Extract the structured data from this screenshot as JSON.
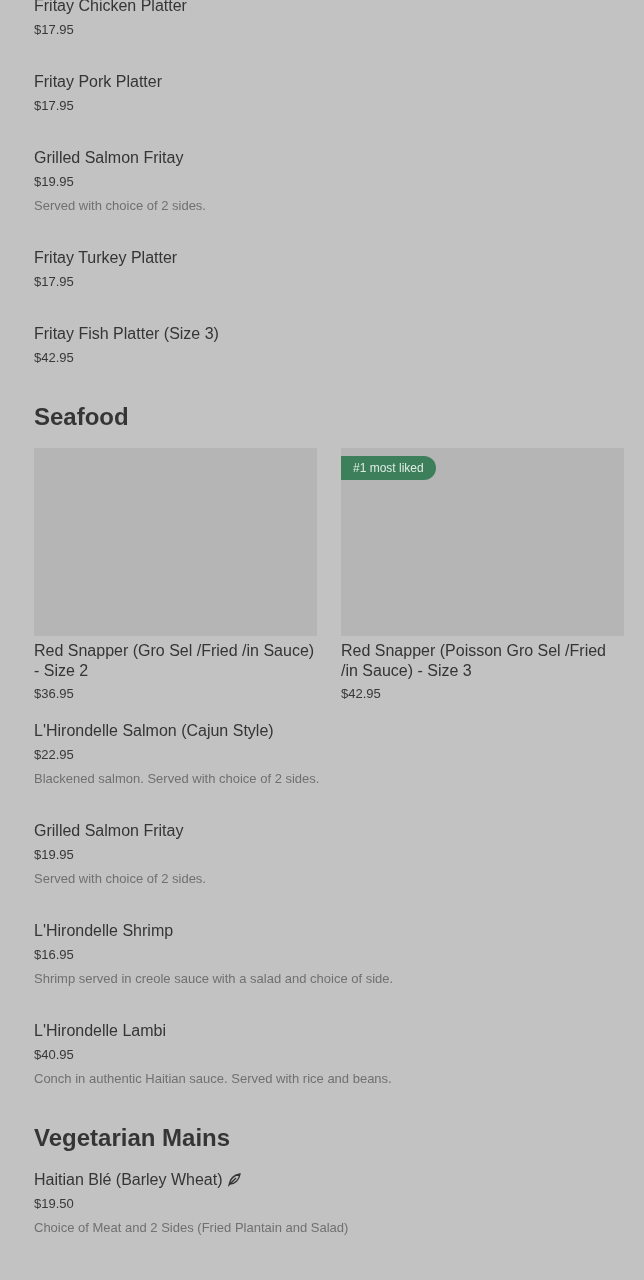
{
  "sections": [
    {
      "items": [
        {
          "name": "Fritay Chicken Platter",
          "price": "$17.95"
        },
        {
          "name": "Fritay Pork Platter",
          "price": "$17.95"
        },
        {
          "name": "Grilled Salmon Fritay",
          "price": "$19.95",
          "description": "Served with choice of 2 sides."
        },
        {
          "name": "Fritay Turkey Platter",
          "price": "$17.95"
        },
        {
          "name": "Fritay Fish Platter (Size 3)",
          "price": "$42.95"
        }
      ]
    },
    {
      "title": "Seafood",
      "featured": [
        {
          "name": "Red Snapper (Gro Sel /Fried /in Sauce) - Size 2",
          "price": "$36.95"
        },
        {
          "name": "Red Snapper (Poisson Gro Sel /Fried /in Sauce) - Size 3",
          "price": "$42.95",
          "badge": "#1 most liked"
        }
      ],
      "items": [
        {
          "name": "L'Hirondelle Salmon (Cajun Style)",
          "price": "$22.95",
          "description": "Blackened salmon. Served with choice of 2 sides."
        },
        {
          "name": "Grilled Salmon Fritay",
          "price": "$19.95",
          "description": "Served with choice of 2 sides."
        },
        {
          "name": "L'Hirondelle Shrimp",
          "price": "$16.95",
          "description": "Shrimp served in creole sauce with a salad and choice of side."
        },
        {
          "name": "L'Hirondelle Lambi",
          "price": "$40.95",
          "description": "Conch in authentic Haitian sauce. Served with rice and beans."
        }
      ]
    },
    {
      "title": "Vegetarian Mains",
      "items": [
        {
          "name": "Haitian Blé (Barley Wheat)",
          "price": "$19.50",
          "description": "Choice of Meat and 2 Sides (Fried Plantain and Salad)",
          "vegetarian": true
        }
      ]
    }
  ]
}
